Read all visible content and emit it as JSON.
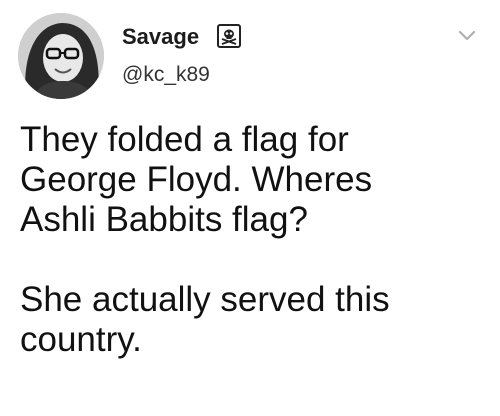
{
  "author": {
    "display_name": "Savage",
    "handle": "@kc_k89",
    "badge_icon": "skull-crossbones-icon",
    "avatar_icon": "profile-photo"
  },
  "menu": {
    "icon": "chevron-down-icon"
  },
  "tweet": {
    "lines": [
      "They folded a flag for",
      "George Floyd. Wheres",
      "Ashli Babbits flag?",
      "She actually served this",
      "country."
    ]
  },
  "colors": {
    "background": "#ffffff",
    "text": "#111111",
    "chevron": "#b0b0b0"
  }
}
